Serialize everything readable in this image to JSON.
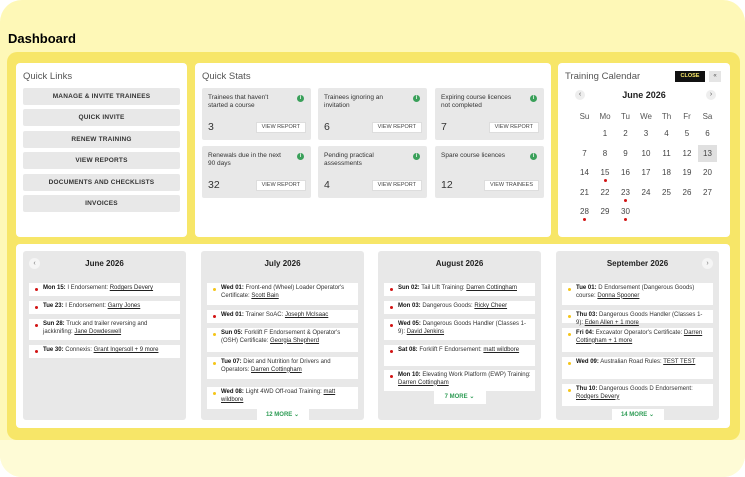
{
  "page_title": "Dashboard",
  "colors": {
    "accent": "#f7e668",
    "background": "#fef8b7",
    "green": "#2e9c55",
    "red_dot": "#d21414",
    "yellow_dot": "#f5c518"
  },
  "quick_links": {
    "title": "Quick Links",
    "items": [
      "MANAGE & INVITE TRAINEES",
      "QUICK INVITE",
      "RENEW TRAINING",
      "VIEW REPORTS",
      "DOCUMENTS AND CHECKLISTS",
      "INVOICES"
    ]
  },
  "quick_stats": {
    "title": "Quick Stats",
    "info_icon": "info-icon",
    "items": [
      {
        "label": "Trainees that haven't started a course",
        "value": "3",
        "button": "VIEW REPORT"
      },
      {
        "label": "Trainees ignoring an invitation",
        "value": "6",
        "button": "VIEW REPORT"
      },
      {
        "label": "Expiring course licences not completed",
        "value": "7",
        "button": "VIEW REPORT"
      },
      {
        "label": "Renewals due in the next 90 days",
        "value": "32",
        "button": "VIEW REPORT"
      },
      {
        "label": "Pending practical assessments",
        "value": "4",
        "button": "VIEW REPORT"
      },
      {
        "label": "Spare course licences",
        "value": "12",
        "button": "VIEW TRAINEES"
      }
    ]
  },
  "calendar": {
    "title": "Training Calendar",
    "close_label": "CLOSE",
    "expand_label": "«",
    "month": "June 2026",
    "prev": "‹",
    "next": "›",
    "weekdays": [
      "Su",
      "Mo",
      "Tu",
      "We",
      "Th",
      "Fr",
      "Sa"
    ],
    "weeks": [
      [
        "",
        "1",
        "2",
        "3",
        "4",
        "5",
        "6"
      ],
      [
        "7",
        "8",
        "9",
        "10",
        "11",
        "12",
        "13"
      ],
      [
        "14",
        "15",
        "16",
        "17",
        "18",
        "19",
        "20"
      ],
      [
        "21",
        "22",
        "23",
        "24",
        "25",
        "26",
        "27"
      ],
      [
        "28",
        "29",
        "30",
        "",
        "",
        "",
        ""
      ]
    ],
    "today": "13",
    "event_days": [
      "15",
      "23",
      "28",
      "30"
    ]
  },
  "months": [
    {
      "title": "June 2026",
      "more": "",
      "events": [
        {
          "date": "Mon 15:",
          "text": "I Endorsement:",
          "link": "Rodgers Devery",
          "dot": "red"
        },
        {
          "date": "Tue 23:",
          "text": "I Endorsement:",
          "link": "Garry Jones",
          "dot": "red"
        },
        {
          "date": "Sun 28:",
          "text": "Truck and trailer reversing and jackknifing:",
          "link": "Jane Dowdeswell",
          "dot": "red"
        },
        {
          "date": "Tue 30:",
          "text": "Connexis:",
          "link": "Grant Ingersoll + 9 more",
          "dot": "red"
        }
      ]
    },
    {
      "title": "July 2026",
      "more": "12 MORE",
      "events": [
        {
          "date": "Wed 01:",
          "text": "Front-end (Wheel) Loader Operator's Certificate:",
          "link": "Scott Bain",
          "dot": "yellow"
        },
        {
          "date": "Wed 01:",
          "text": "Trainer SoAC:",
          "link": "Joseph McIsaac",
          "dot": "red"
        },
        {
          "date": "Sun 05:",
          "text": "Forklift F Endorsement & Operator's (OSH) Certificate:",
          "link": "Georgia Shepherd",
          "dot": "yellow"
        },
        {
          "date": "Tue 07:",
          "text": "Diet and Nutrition for Drivers and Operators:",
          "link": "Darren Cottingham",
          "dot": "yellow"
        },
        {
          "date": "Wed 08:",
          "text": "Light 4WD Off-road Training:",
          "link": "matt wildbore",
          "dot": "yellow"
        }
      ]
    },
    {
      "title": "August 2026",
      "more": "7 MORE",
      "events": [
        {
          "date": "Sun 02:",
          "text": "Tail Lift Training:",
          "link": "Darren Cottingham",
          "dot": "red"
        },
        {
          "date": "Mon 03:",
          "text": "Dangerous Goods:",
          "link": "Ricky Cheer",
          "dot": "red"
        },
        {
          "date": "Wed 05:",
          "text": "Dangerous Goods Handler (Classes 1-9):",
          "link": "David Jenkins",
          "dot": "red"
        },
        {
          "date": "Sat 08:",
          "text": "Forklift F Endorsement:",
          "link": "matt wildbore",
          "dot": "red"
        },
        {
          "date": "Mon 10:",
          "text": "Elevating Work Platform (EWP) Training:",
          "link": "Darren Cottingham",
          "dot": "red"
        }
      ]
    },
    {
      "title": "September 2026",
      "more": "14 MORE",
      "events": [
        {
          "date": "Tue 01:",
          "text": "D Endorsement (Dangerous Goods) course:",
          "link": "Donna Spooner",
          "dot": "yellow"
        },
        {
          "date": "Thu 03:",
          "text": "Dangerous Goods Handler (Classes 1-9):",
          "link": "Eden Allen + 1 more",
          "dot": "yellow"
        },
        {
          "date": "Fri 04:",
          "text": "Excavator Operator's Certificate:",
          "link": "Darren Cottingham + 1 more",
          "dot": "yellow"
        },
        {
          "date": "Wed 09:",
          "text": "Australian Road Rules:",
          "link": "TEST TEST",
          "dot": "yellow"
        },
        {
          "date": "Thu 10:",
          "text": "Dangerous Goods D Endorsement:",
          "link": "Rodgers Devery",
          "dot": "yellow"
        }
      ]
    }
  ],
  "months_nav": {
    "prev": "‹",
    "next": "›"
  }
}
